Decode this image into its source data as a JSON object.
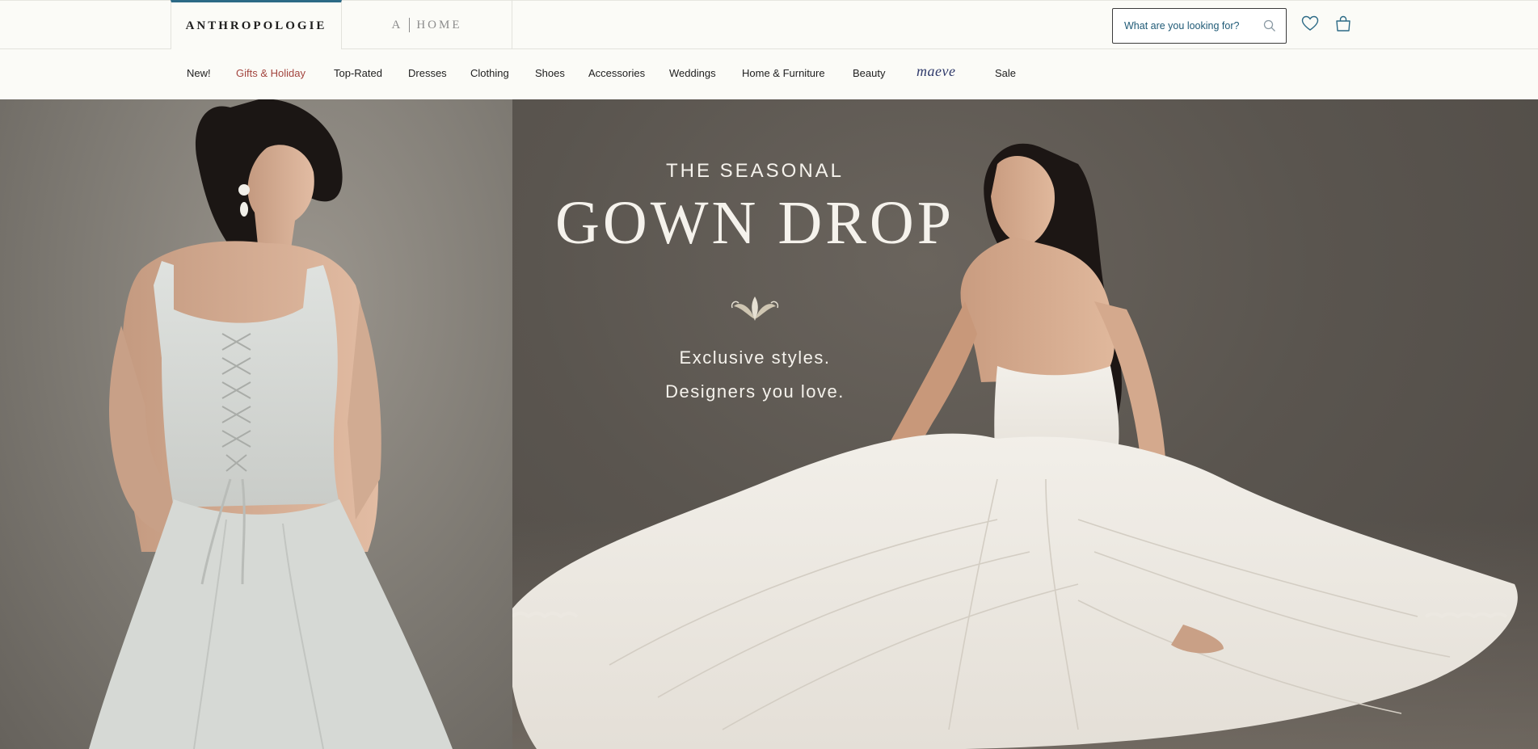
{
  "header": {
    "brand_tabs": [
      {
        "label": "ANTHROPOLOGIE",
        "active": true
      },
      {
        "label_prefix": "A",
        "label_suffix": "HOME",
        "active": false
      }
    ],
    "search": {
      "placeholder": "What are you looking for?"
    },
    "icons": [
      "search-icon",
      "heart-icon",
      "shopping-bag-icon"
    ],
    "accent_color": "#2c6a86"
  },
  "nav": {
    "items": [
      {
        "label": "New!"
      },
      {
        "label": "Gifts & Holiday",
        "color": "#a3453f"
      },
      {
        "label": "Top-Rated"
      },
      {
        "label": "Dresses"
      },
      {
        "label": "Clothing"
      },
      {
        "label": "Shoes"
      },
      {
        "label": "Accessories"
      },
      {
        "label": "Weddings"
      },
      {
        "label": "Home & Furniture"
      },
      {
        "label": "Beauty"
      },
      {
        "label": "maeve",
        "logo": true
      },
      {
        "label": "Sale"
      }
    ]
  },
  "hero": {
    "kicker": "THE SEASONAL",
    "headline": "GOWN DROP",
    "line1": "Exclusive styles.",
    "line2": "Designers you love.",
    "ornament_icon": "fleur-ornament-icon",
    "images": [
      "model-back-lace-up-gown",
      "model-seated-pleated-gown"
    ]
  }
}
